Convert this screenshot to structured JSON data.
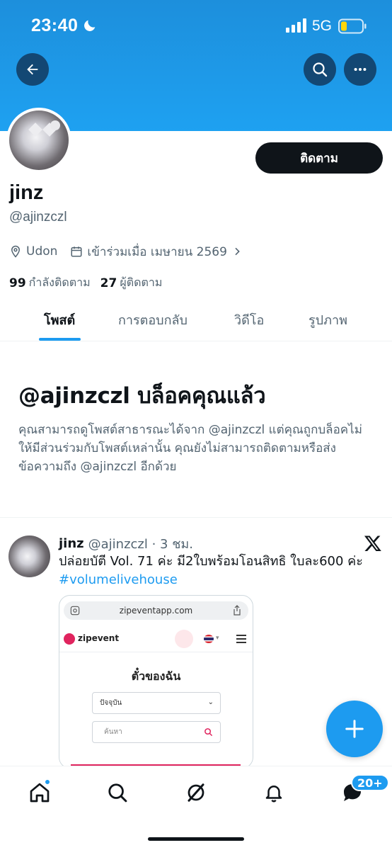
{
  "status_bar": {
    "time": "23:40",
    "network": "5G"
  },
  "profile": {
    "name": "jinz",
    "handle": "@ajinzczl",
    "follow_label": "ติดตาม",
    "location": "Udon",
    "joined": "เข้าร่วมเมื่อ เมษายน 2569",
    "following_count": "99",
    "following_label": "กำลังติดตาม",
    "followers_count": "27",
    "followers_label": "ผู้ติดตาม"
  },
  "tabs": [
    {
      "label": "โพสต์",
      "active": true
    },
    {
      "label": "การตอบกลับ",
      "active": false
    },
    {
      "label": "วิดีโอ",
      "active": false
    },
    {
      "label": "รูปภาพ",
      "active": false
    }
  ],
  "blocked_notice": {
    "title": "@ajinzczl บล็อคคุณแล้ว",
    "body": "คุณสามารถดูโพสต์สาธารณะได้จาก @ajinzczl แต่คุณถูกบล็อคไม่ให้มีส่วนร่วมกับโพสต์เหล่านั้น คุณยังไม่สามารถติดตามหรือส่งข้อความถึง @ajinzczl อีกด้วย"
  },
  "tweet": {
    "name": "jinz",
    "meta": "@ajinzczl · 3 ชม.",
    "text": "ปล่อยบัตี Vol. 71 ค่ะ มี2ใบพร้อมโอนสิทธิ ใบละ600 ค่ะ",
    "hashtag": "#volumelivehouse",
    "media": {
      "url": "zipeventapp.com",
      "site_name": "zipevent",
      "heading": "ตั๋วของฉัน",
      "select_value": "ปัจจุบัน",
      "search_placeholder": "ค้นหา"
    }
  },
  "bottom_nav": {
    "notification_badge": "20+"
  },
  "colors": {
    "accent": "#1d9bf0",
    "banner": "#1ea1f1",
    "text": "#0f1419",
    "muted": "#536471"
  }
}
